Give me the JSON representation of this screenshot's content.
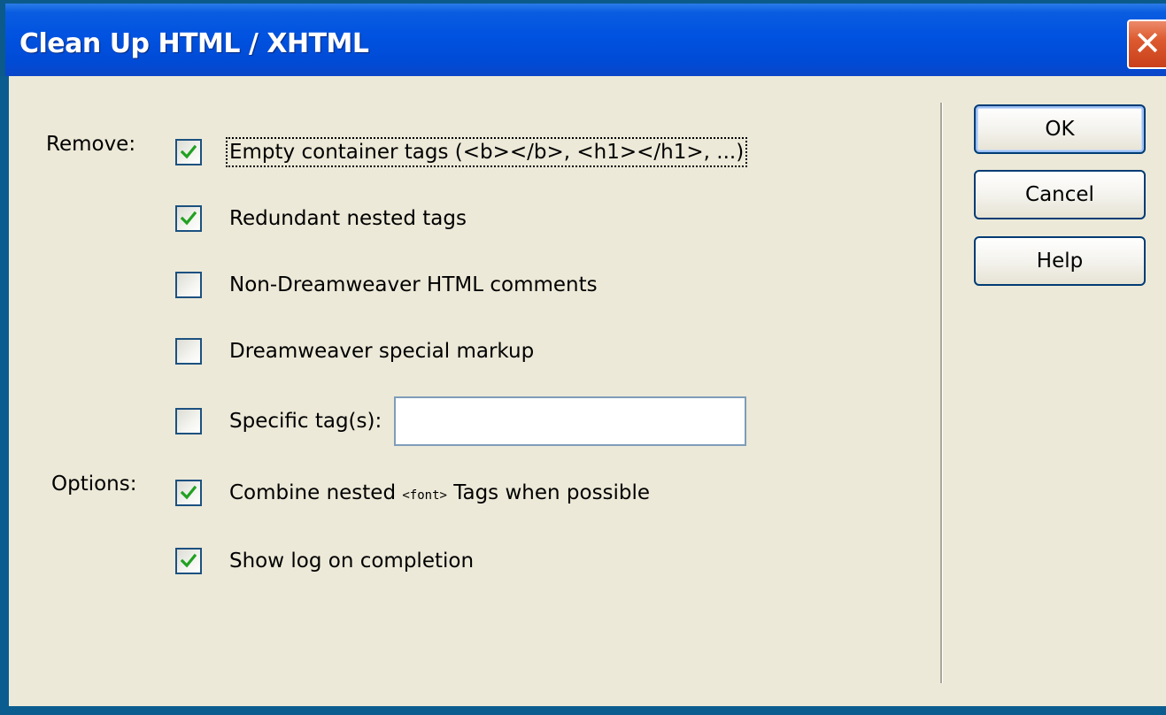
{
  "window": {
    "title": "Clean Up HTML / XHTML",
    "close_glyph": "✕"
  },
  "remove": {
    "label": "Remove:",
    "items": [
      {
        "label": "Empty container tags (<b></b>, <h1></h1>, ...)",
        "checked": true
      },
      {
        "label": "Redundant nested tags",
        "checked": true
      },
      {
        "label": "Non-Dreamweaver HTML comments",
        "checked": false
      },
      {
        "label": "Dreamweaver special markup",
        "checked": false
      },
      {
        "label": "Specific tag(s):",
        "checked": false,
        "input_value": ""
      }
    ]
  },
  "options": {
    "label": "Options:",
    "items": [
      {
        "label_prefix": "Combine nested ",
        "label_code": "<font>",
        "label_suffix": " Tags when possible",
        "checked": true
      },
      {
        "label": "Show log on completion",
        "checked": true
      }
    ]
  },
  "buttons": {
    "ok": "OK",
    "cancel": "Cancel",
    "help": "Help"
  },
  "colors": {
    "titlebar": "#0052e0",
    "dialog_bg": "#ece9d8",
    "checkmark": "#21a121",
    "checkbox_border": "#1c5180",
    "close_button": "#dd5a30"
  }
}
